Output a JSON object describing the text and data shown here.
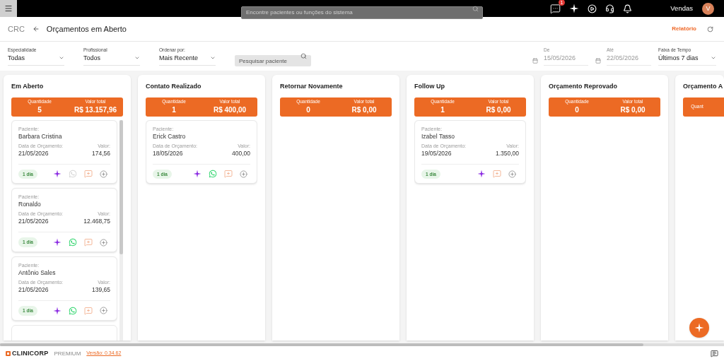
{
  "topbar": {
    "search": {
      "placeholder": "Encontre pacientes ou funções do sistema"
    },
    "notification_count": "1",
    "user": {
      "name": "Vendas",
      "initial": "V"
    }
  },
  "header": {
    "breadcrumb": "CRC",
    "title": "Orçamentos em Aberto",
    "report_link": "Relatório"
  },
  "filters": {
    "selects": [
      {
        "label": "Especialidade",
        "value": "Todas"
      },
      {
        "label": "Profissional",
        "value": "Todos"
      },
      {
        "label": "Ordenar por:",
        "value": "Mais Recente"
      }
    ],
    "search": {
      "placeholder": "Pesquisar paciente"
    },
    "dates": [
      {
        "label": "De",
        "value": "15/05/2026",
        "disabled": true
      },
      {
        "label": "Até",
        "value": "22/05/2026",
        "disabled": true
      }
    ],
    "range": {
      "label": "Faixa de Tempo",
      "value": "Últimos 7 dias"
    }
  },
  "columns": [
    {
      "title": "Em Aberto",
      "quantity_label": "Quantidade",
      "quantity": "5",
      "total_label": "Valor total",
      "total": "R$ 13.157,96",
      "more_below": true,
      "cards": [
        {
          "patient_label": "Paciente:",
          "patient": "Barbara Cristina",
          "date_label": "Data de Orçamento:",
          "date": "21/05/2026",
          "value_label": "Valor:",
          "value": "174,56",
          "age": "1 dia",
          "whatsapp": {
            "disabled": true
          }
        },
        {
          "patient_label": "Paciente:",
          "patient": "Ronaldo",
          "date_label": "Data de Orçamento:",
          "date": "21/05/2026",
          "value_label": "Valor:",
          "value": "12.468,75",
          "age": "1 dia",
          "whatsapp": {
            "disabled": false
          }
        },
        {
          "patient_label": "Paciente:",
          "patient": "Antônio Sales",
          "date_label": "Data de Orçamento:",
          "date": "21/05/2026",
          "value_label": "Valor:",
          "value": "139,65",
          "age": "1 dia",
          "whatsapp": {
            "disabled": false
          }
        }
      ]
    },
    {
      "title": "Contato Realizado",
      "quantity_label": "Quantidade",
      "quantity": "1",
      "total_label": "Valor total",
      "total": "R$ 400,00",
      "more_below": false,
      "cards": [
        {
          "patient_label": "Paciente:",
          "patient": "Erick Castro",
          "date_label": "Data de Orçamento:",
          "date": "18/05/2026",
          "value_label": "Valor:",
          "value": "400,00",
          "age": "1 dia",
          "whatsapp": {
            "disabled": false
          }
        }
      ]
    },
    {
      "title": "Retornar Novamente",
      "quantity_label": "Quantidade",
      "quantity": "0",
      "total_label": "Valor total",
      "total": "R$ 0,00",
      "more_below": false
    },
    {
      "title": "Follow Up",
      "quantity_label": "Quantidade",
      "quantity": "1",
      "total_label": "Valor total",
      "total": "R$ 0,00",
      "more_below": false,
      "cards": [
        {
          "patient_label": "Paciente:",
          "patient": "Izabel Tasso",
          "date_label": "Data de Orçamento:",
          "date": "19/05/2026",
          "value_label": "Valor:",
          "value": "1.350,00",
          "age": "1 dia"
        }
      ]
    },
    {
      "title": "Orçamento Reprovado",
      "quantity_label": "Quantidade",
      "quantity": "0",
      "total_label": "Valor total",
      "total": "R$ 0,00",
      "more_below": false
    },
    {
      "title": "Orçamento A",
      "quantity_label": "Quant",
      "more_below": false
    }
  ],
  "footer": {
    "brand": "CLINICORP",
    "plan": "PREMIUM",
    "version": "Versão: 0.34.62"
  }
}
